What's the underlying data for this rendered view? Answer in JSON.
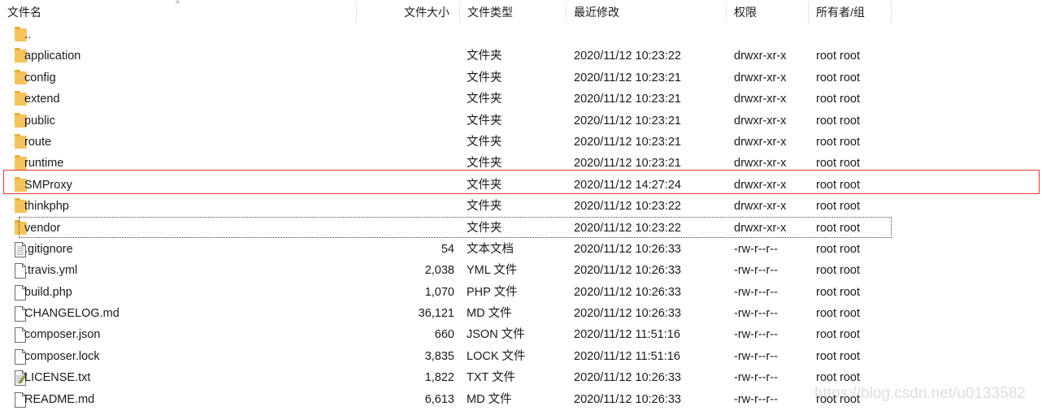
{
  "columns": {
    "name": "文件名",
    "size": "文件大小",
    "type": "文件类型",
    "modified": "最近修改",
    "permissions": "权限",
    "owner": "所有者/组"
  },
  "sort_indicator": "^",
  "rows": [
    {
      "name": "..",
      "size": "",
      "type": "",
      "modified": "",
      "perm": "",
      "owner": "",
      "icon": "folder-icon"
    },
    {
      "name": "application",
      "size": "",
      "type": "文件夹",
      "modified": "2020/11/12 10:23:22",
      "perm": "drwxr-xr-x",
      "owner": "root root",
      "icon": "folder-icon"
    },
    {
      "name": "config",
      "size": "",
      "type": "文件夹",
      "modified": "2020/11/12 10:23:21",
      "perm": "drwxr-xr-x",
      "owner": "root root",
      "icon": "folder-icon"
    },
    {
      "name": "extend",
      "size": "",
      "type": "文件夹",
      "modified": "2020/11/12 10:23:21",
      "perm": "drwxr-xr-x",
      "owner": "root root",
      "icon": "folder-icon"
    },
    {
      "name": "public",
      "size": "",
      "type": "文件夹",
      "modified": "2020/11/12 10:23:21",
      "perm": "drwxr-xr-x",
      "owner": "root root",
      "icon": "folder-icon"
    },
    {
      "name": "route",
      "size": "",
      "type": "文件夹",
      "modified": "2020/11/12 10:23:21",
      "perm": "drwxr-xr-x",
      "owner": "root root",
      "icon": "folder-icon"
    },
    {
      "name": "runtime",
      "size": "",
      "type": "文件夹",
      "modified": "2020/11/12 10:23:21",
      "perm": "drwxr-xr-x",
      "owner": "root root",
      "icon": "folder-icon"
    },
    {
      "name": "SMProxy",
      "size": "",
      "type": "文件夹",
      "modified": "2020/11/12 14:27:24",
      "perm": "drwxr-xr-x",
      "owner": "root root",
      "icon": "folder-icon"
    },
    {
      "name": "thinkphp",
      "size": "",
      "type": "文件夹",
      "modified": "2020/11/12 10:23:22",
      "perm": "drwxr-xr-x",
      "owner": "root root",
      "icon": "folder-icon"
    },
    {
      "name": "vendor",
      "size": "",
      "type": "文件夹",
      "modified": "2020/11/12 10:23:22",
      "perm": "drwxr-xr-x",
      "owner": "root root",
      "icon": "folder-icon"
    },
    {
      "name": ".gitignore",
      "size": "54",
      "type": "文本文档",
      "modified": "2020/11/12 10:26:33",
      "perm": "-rw-r--r--",
      "owner": "root root",
      "icon": "text-file-icon"
    },
    {
      "name": ".travis.yml",
      "size": "2,038",
      "type": "YML 文件",
      "modified": "2020/11/12 10:26:33",
      "perm": "-rw-r--r--",
      "owner": "root root",
      "icon": "file-icon"
    },
    {
      "name": "build.php",
      "size": "1,070",
      "type": "PHP 文件",
      "modified": "2020/11/12 10:26:33",
      "perm": "-rw-r--r--",
      "owner": "root root",
      "icon": "file-icon"
    },
    {
      "name": "CHANGELOG.md",
      "size": "36,121",
      "type": "MD 文件",
      "modified": "2020/11/12 10:26:33",
      "perm": "-rw-r--r--",
      "owner": "root root",
      "icon": "file-icon"
    },
    {
      "name": "composer.json",
      "size": "660",
      "type": "JSON 文件",
      "modified": "2020/11/12 11:51:16",
      "perm": "-rw-r--r--",
      "owner": "root root",
      "icon": "file-icon"
    },
    {
      "name": "composer.lock",
      "size": "3,835",
      "type": "LOCK 文件",
      "modified": "2020/11/12 11:51:16",
      "perm": "-rw-r--r--",
      "owner": "root root",
      "icon": "file-icon"
    },
    {
      "name": "LICENSE.txt",
      "size": "1,822",
      "type": "TXT 文件",
      "modified": "2020/11/12 10:26:33",
      "perm": "-rw-r--r--",
      "owner": "root root",
      "icon": "notepad-file-icon"
    },
    {
      "name": "README.md",
      "size": "6,613",
      "type": "MD 文件",
      "modified": "2020/11/12 10:26:33",
      "perm": "-rw-r--r--",
      "owner": "root root",
      "icon": "file-icon"
    }
  ],
  "highlighted_row": "SMProxy",
  "focused_row": "vendor",
  "watermark": "https://blog.csdn.net/u0133582",
  "colors": {
    "folder": "#f4c35b",
    "highlight_border": "#e53935"
  }
}
